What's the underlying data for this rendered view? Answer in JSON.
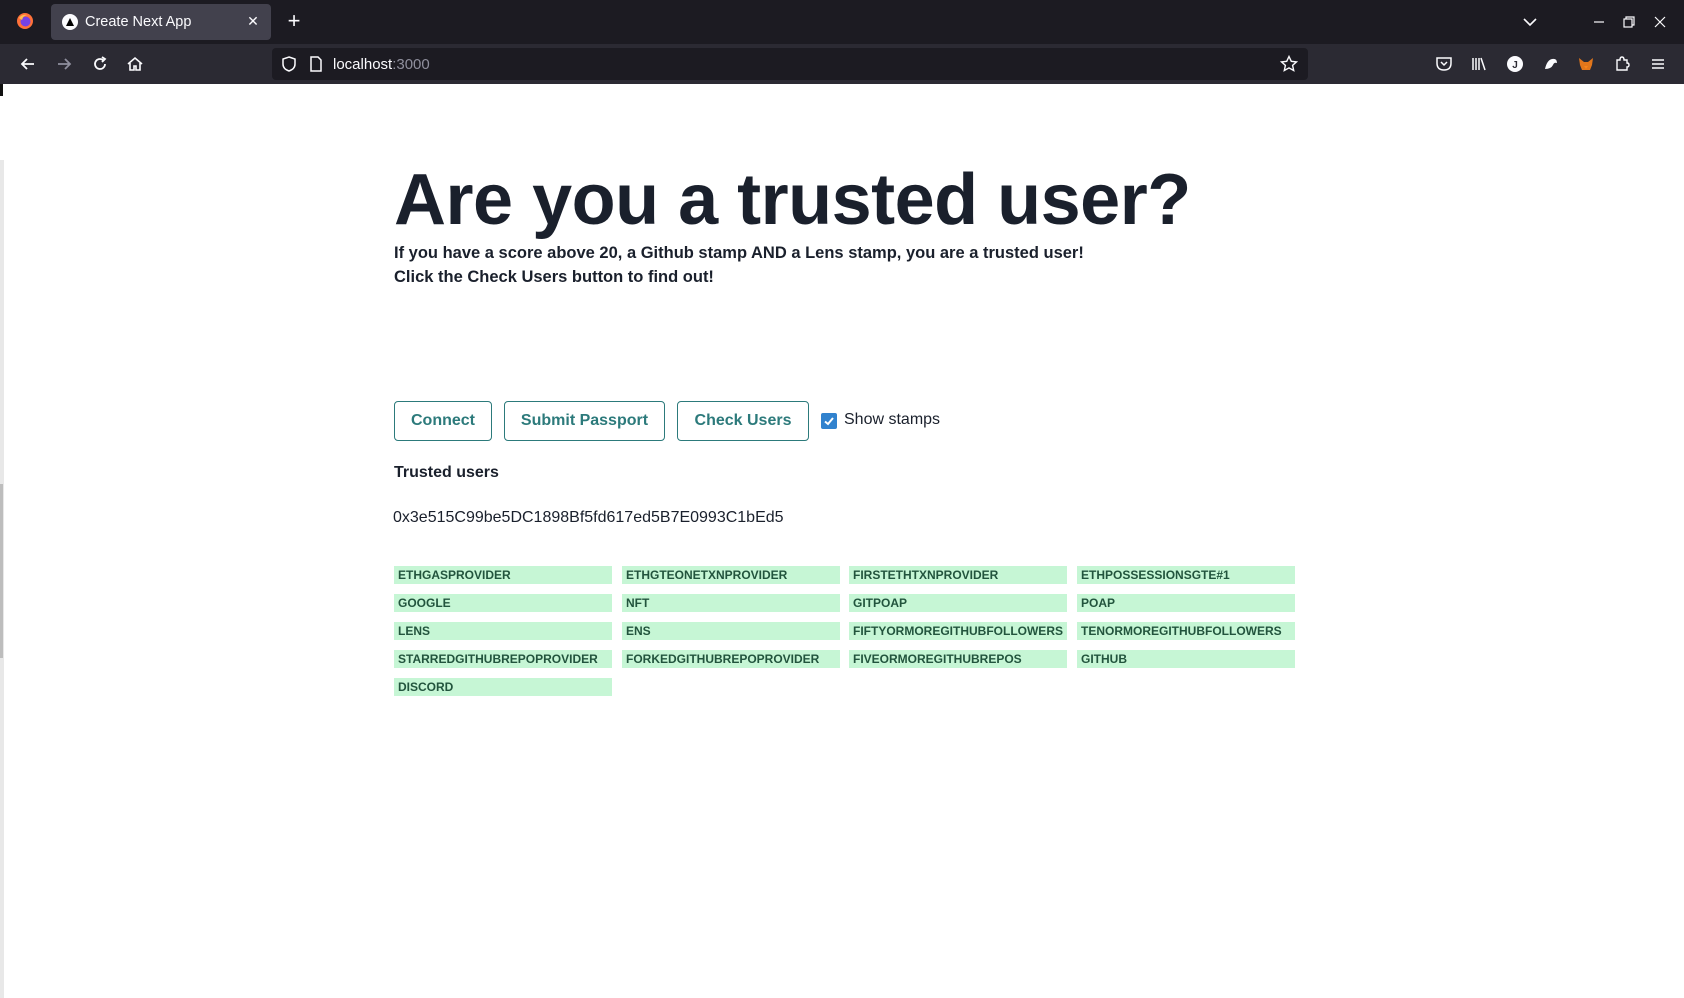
{
  "browser": {
    "tab_title": "Create Next App",
    "url_host": "localhost",
    "url_port": ":3000",
    "icons": [
      "firefox-icon",
      "tab-favicon-icon",
      "close-icon",
      "plus-icon",
      "chevron-down-icon",
      "minimize-icon",
      "restore-icon",
      "close-window-icon",
      "back-icon",
      "forward-icon",
      "reload-icon",
      "home-icon",
      "shield-icon",
      "page-icon",
      "star-icon",
      "pocket-icon",
      "library-icon",
      "account-icon",
      "extension-icon",
      "metamask-icon",
      "extensions-icon",
      "menu-icon"
    ]
  },
  "page": {
    "heading": "Are you a trusted user?",
    "intro_line1": "If you have a score above 20, a Github stamp AND a Lens stamp, you are a trusted user!",
    "intro_line2": "Click the Check Users button to find out!",
    "buttons": {
      "connect": "Connect",
      "submit_passport": "Submit Passport",
      "check_users": "Check Users"
    },
    "show_stamps": {
      "label": "Show stamps",
      "checked": true
    },
    "trusted_users_heading": "Trusted users",
    "trusted_address": "0x3e515C99be5DC1898Bf5fd617ed5B7E0993C1bEd5",
    "stamps": [
      "ETHGASPROVIDER",
      "ETHGTEONETXNPROVIDER",
      "FIRSTETHTXNPROVIDER",
      "ETHPOSSESSIONSGTE#1",
      "GOOGLE",
      "NFT",
      "GITPOAP",
      "POAP",
      "LENS",
      "ENS",
      "FIFTYORMOREGITHUBFOLLOWERS",
      "TENORMOREGITHUBFOLLOWERS",
      "STARREDGITHUBREPOPROVIDER",
      "FORKEDGITHUBREPOPROVIDER",
      "FIVEORMOREGITHUBREPOS",
      "GITHUB",
      "DISCORD"
    ],
    "colors": {
      "accent": "#2c7a7b",
      "stamp_bg": "#c6f6d5",
      "stamp_text": "#22543d",
      "checkbox": "#3182ce"
    }
  }
}
